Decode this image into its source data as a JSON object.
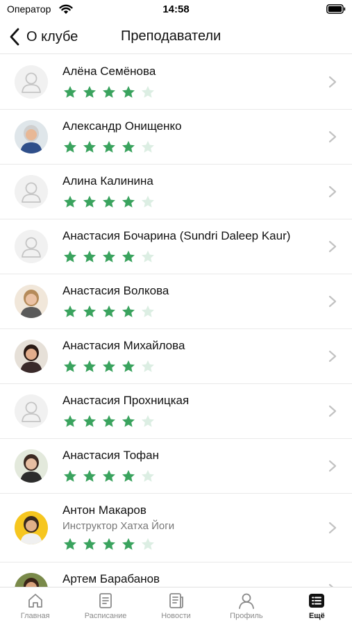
{
  "status": {
    "carrier": "Оператор",
    "time": "14:58"
  },
  "nav": {
    "back_label": "О клубе",
    "title": "Преподаватели"
  },
  "colors": {
    "star_filled": "#3aa35e",
    "star_empty": "#dceee3"
  },
  "teachers": [
    {
      "name": "Алёна Семёнова",
      "rating": 4,
      "avatar": "placeholder"
    },
    {
      "name": "Александр Онищенко",
      "rating": 4,
      "avatar": "photo"
    },
    {
      "name": "Алина Калинина",
      "rating": 4,
      "avatar": "placeholder"
    },
    {
      "name": "Анастасия Бочарина (Sundri Daleep Kaur)",
      "rating": 4,
      "avatar": "placeholder"
    },
    {
      "name": "Анастасия Волкова",
      "rating": 4,
      "avatar": "photo"
    },
    {
      "name": "Анастасия Михайлова",
      "rating": 4,
      "avatar": "photo"
    },
    {
      "name": "Анастасия Прохницкая",
      "rating": 4,
      "avatar": "placeholder"
    },
    {
      "name": "Анастасия Тофан",
      "rating": 4,
      "avatar": "photo"
    },
    {
      "name": "Антон Макаров",
      "role": "Инструктор Хатха Йоги",
      "rating": 4,
      "avatar": "photo"
    },
    {
      "name": "Артем Барабанов",
      "rating": 4,
      "avatar": "photo"
    }
  ],
  "tabs": [
    {
      "label": "Главная",
      "icon": "home-icon"
    },
    {
      "label": "Расписание",
      "icon": "schedule-icon"
    },
    {
      "label": "Новости",
      "icon": "news-icon"
    },
    {
      "label": "Профиль",
      "icon": "profile-icon"
    },
    {
      "label": "Ещё",
      "icon": "more-icon",
      "active": true
    }
  ]
}
